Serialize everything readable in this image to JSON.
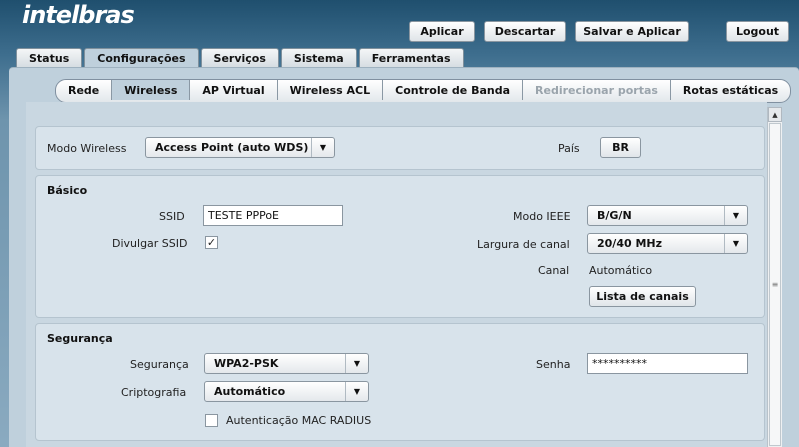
{
  "brand": {
    "logo": "intelbras"
  },
  "top_buttons": {
    "apply": "Aplicar",
    "discard": "Descartar",
    "save_apply": "Salvar e Aplicar",
    "logout": "Logout"
  },
  "tabs": [
    {
      "label": "Status",
      "active": false
    },
    {
      "label": "Configurações",
      "active": true
    },
    {
      "label": "Serviços",
      "active": false
    },
    {
      "label": "Sistema",
      "active": false
    },
    {
      "label": "Ferramentas",
      "active": false
    }
  ],
  "subtabs": [
    {
      "label": "Rede",
      "state": "normal"
    },
    {
      "label": "Wireless",
      "state": "active"
    },
    {
      "label": "AP Virtual",
      "state": "normal"
    },
    {
      "label": "Wireless ACL",
      "state": "normal"
    },
    {
      "label": "Controle de Banda",
      "state": "normal"
    },
    {
      "label": "Redirecionar portas",
      "state": "disabled"
    },
    {
      "label": "Rotas estáticas",
      "state": "normal"
    }
  ],
  "mode": {
    "label": "Modo Wireless",
    "value": "Access Point (auto WDS)",
    "country_label": "País",
    "country_value": "BR"
  },
  "basic": {
    "title": "Básico",
    "ssid_label": "SSID",
    "ssid_value": "TESTE PPPoE",
    "broadcast_label": "Divulgar SSID",
    "broadcast_checked": true,
    "checkmark": "✓",
    "ieee_label": "Modo IEEE",
    "ieee_value": "B/G/N",
    "width_label": "Largura de canal",
    "width_value": "20/40 MHz",
    "channel_label": "Canal",
    "channel_value": "Automático",
    "channel_list_button": "Lista de canais"
  },
  "security": {
    "title": "Segurança",
    "security_label": "Segurança",
    "security_value": "WPA2-PSK",
    "crypto_label": "Criptografia",
    "crypto_value": "Automático",
    "radius_label": "Autenticação MAC RADIUS",
    "radius_checked": false,
    "password_label": "Senha",
    "password_value": "**********"
  },
  "icons": {
    "dropdown": "▼",
    "scroll_up": "▲",
    "scroll_down": "▼",
    "grip": "≡"
  },
  "colors": {
    "header_bg": "#1f4f6e",
    "panel_bg": "#bfd0dc",
    "section_bg": "#d8e3eb"
  }
}
